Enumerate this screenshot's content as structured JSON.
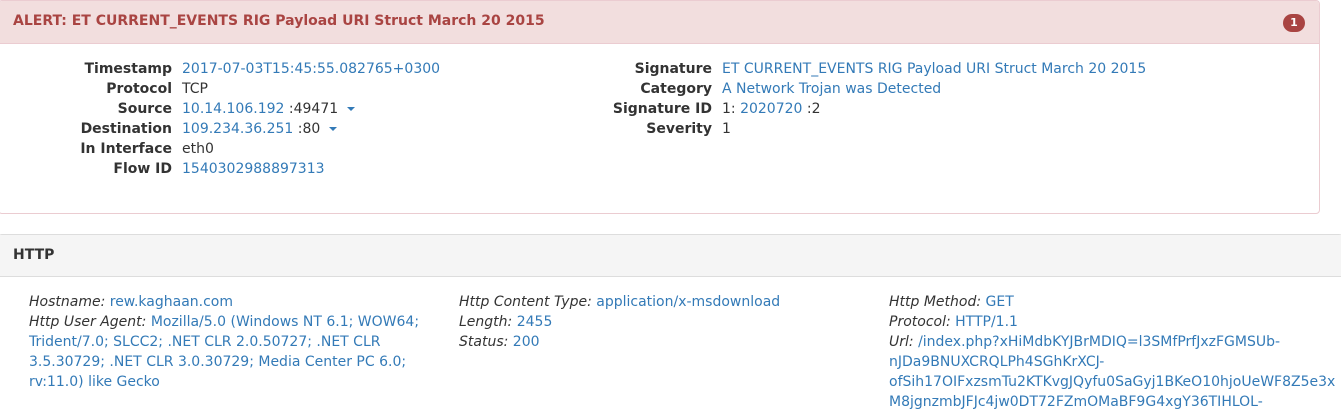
{
  "alert": {
    "title": "ALERT: ET CURRENT_EVENTS RIG Payload URI Struct March 20 2015",
    "count": "1",
    "timestamp_label": "Timestamp",
    "timestamp": "2017-07-03T15:45:55.082765+0300",
    "protocol_label": "Protocol",
    "protocol": "TCP",
    "source_label": "Source",
    "source_ip": "10.14.106.192",
    "source_port": ":49471",
    "destination_label": "Destination",
    "destination_ip": "109.234.36.251",
    "destination_port": ":80",
    "interface_label": "In Interface",
    "interface": "eth0",
    "flow_label": "Flow ID",
    "flow_id": "1540302988897313",
    "signature_label": "Signature",
    "signature": "ET CURRENT_EVENTS RIG Payload URI Struct March 20 2015",
    "category_label": "Category",
    "category": "A Network Trojan was Detected",
    "sigid_label": "Signature ID",
    "sigid_gid": "1:",
    "sigid_sid": "2020720",
    "sigid_rev": ":2",
    "severity_label": "Severity",
    "severity": "1"
  },
  "http": {
    "title": "HTTP",
    "hostname_label": "Hostname:",
    "hostname": "rew.kaghaan.com",
    "useragent_label": "Http User Agent:",
    "useragent_lines": [
      "Mozilla/5.0 (Windows NT 6.1; WOW64;",
      "Trident/7.0; SLCC2; .NET CLR 2.0.50727; .NET CLR",
      "3.5.30729; .NET CLR 3.0.30729; Media Center PC 6.0;",
      "rv:11.0) like Gecko"
    ],
    "content_type_label": "Http Content Type:",
    "content_type": "application/x-msdownload",
    "length_label": "Length:",
    "length": "2455",
    "status_label": "Status:",
    "status": "200",
    "method_label": "Http Method:",
    "method": "GET",
    "protocol_label": "Protocol:",
    "protocol": "HTTP/1.1",
    "url_label": "Url:",
    "url_lines": [
      "/index.php?xHiMdbKYJBrMDIQ=l3SMfPrfJxzFGMSUb-",
      "nJDa9BNUXCRQLPh4SGhKrXCJ-",
      "ofSih17OIFxzsmTu2KTKvgJQyfu0SaGyj1BKeO10hjoUeWF8Z5e3x",
      "M8jgnzmbJFJc4jw0DT72FZmOMaBF9G4xgY36TIHLOL-"
    ]
  },
  "colors": {
    "alert_bg": "#f2dede",
    "alert_text": "#a94442",
    "link": "#337ab7"
  }
}
